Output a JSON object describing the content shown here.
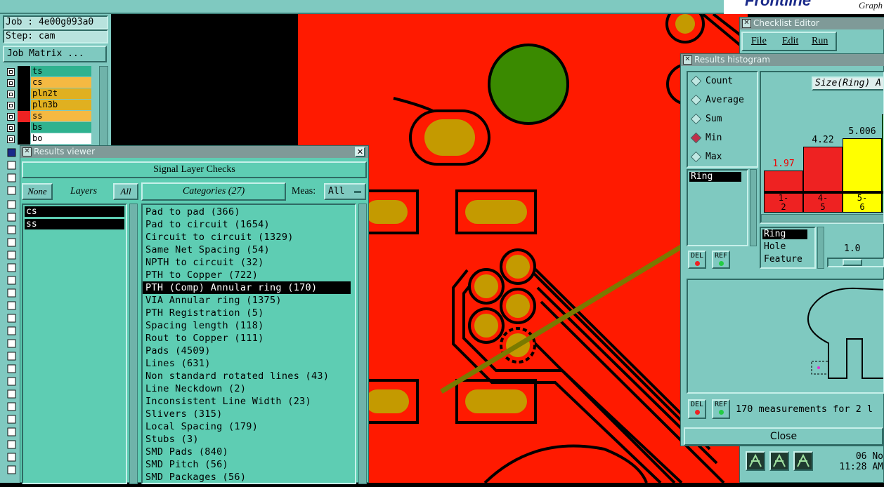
{
  "job_panel": {
    "job": "Job : 4e00g093a0",
    "step": "Step: cam",
    "job_matrix": "Job Matrix ..."
  },
  "layers": [
    {
      "name": "ts",
      "color": "#2fb28f"
    },
    {
      "name": "cs",
      "color": "#f5b942"
    },
    {
      "name": "pln2t",
      "color": "#e0b020"
    },
    {
      "name": "pln3b",
      "color": "#e0b020"
    },
    {
      "name": "ss",
      "color": "#f5b942"
    },
    {
      "name": "bs",
      "color": "#2fb28f"
    },
    {
      "name": "bo",
      "color": "#ffffff"
    }
  ],
  "results_viewer": {
    "title": "Results viewer",
    "header": "Signal Layer Checks",
    "btn_none": "None",
    "btn_layers": "Layers",
    "btn_all": "All",
    "categories_label": "Categories (27)",
    "meas_label": "Meas:",
    "meas_value": "All",
    "layer_list": [
      "cs",
      "ss"
    ],
    "categories": [
      "Pad to pad (366)",
      "Pad to circuit (1654)",
      "Circuit to circuit (1329)",
      "Same Net Spacing (54)",
      "NPTH to circuit (32)",
      "PTH to Copper (722)",
      "PTH (Comp) Annular ring (170)",
      "VIA Annular ring (1375)",
      "PTH Registration (5)",
      "Spacing length (118)",
      "Rout to Copper (111)",
      "Pads (4509)",
      "Lines (631)",
      "Non standard rotated lines (43)",
      "Line Neckdown (2)",
      "Inconsistent Line Width (23)",
      "Slivers (315)",
      "Local Spacing (179)",
      "Stubs (3)",
      "SMD Pads (840)",
      "SMD Pitch (56)",
      "SMD Packages (56)"
    ],
    "selected_index": 6
  },
  "checklist_editor": {
    "title": "Checklist Editor",
    "menu": [
      "File",
      "Edit",
      "Run"
    ]
  },
  "top_logo": {
    "brand_fragment": "Frontline",
    "sub": "Graph"
  },
  "histogram": {
    "title": "Results histogram",
    "options": [
      "Count",
      "Average",
      "Sum",
      "Min",
      "Max"
    ],
    "selected_option": "Min",
    "attr_list_top": [
      "Ring"
    ],
    "size_title": "Size(Ring) A",
    "bars": [
      {
        "label": "1.97",
        "bin": "1-\n2",
        "value": 1.97,
        "color": "#ee2222"
      },
      {
        "label": "4.22",
        "bin": "4-\n5",
        "value": 4.22,
        "color": "#ee2222"
      },
      {
        "label": "5.006",
        "bin": "5-\n6",
        "value": 5.006,
        "color": "#ffff00"
      }
    ],
    "attr_list": [
      "Ring",
      "Hole",
      "Feature"
    ],
    "scale_value": "1.0",
    "btn_del": "DEL",
    "btn_ref": "REF",
    "measurements_text": "170 measurements for 2 l",
    "close": "Close"
  },
  "clock": {
    "date": "06 No",
    "time": "11:28 AM"
  },
  "colors": {
    "pcb_red": "#ff1a00",
    "pad_gold": "#c49a00",
    "panel_teal": "#5ecdb3",
    "arrow": "#7a7a00"
  }
}
